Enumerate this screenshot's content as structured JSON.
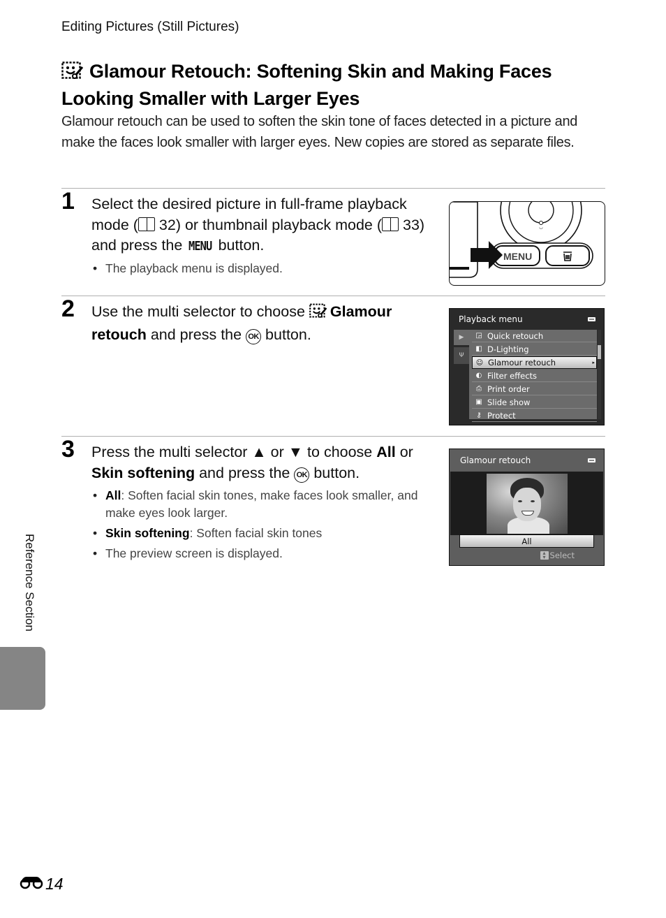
{
  "running_head": "Editing Pictures (Still Pictures)",
  "title": {
    "icon": "glamour-retouch-icon",
    "text": "Glamour Retouch: Softening Skin and Making Faces Looking Smaller with Larger Eyes"
  },
  "intro": "Glamour retouch can be used to soften the skin tone of faces detected in a picture and make the faces look smaller with larger eyes. New copies are stored as separate files.",
  "steps": [
    {
      "number": "1",
      "text_parts": {
        "a": "Select the desired picture in full-frame playback mode (",
        "ref1": "32",
        "b": ") or thumbnail playback mode (",
        "ref2": "33",
        "c": ") and press the ",
        "button": "MENU",
        "d": " button."
      },
      "bullets": [
        "The playback menu is displayed."
      ],
      "illustration": {
        "menu_label": "MENU",
        "delete_icon": "trash-icon"
      }
    },
    {
      "number": "2",
      "text_parts": {
        "a": "Use the multi selector to choose ",
        "bold": "Glamour retouch",
        "b": " and press the ",
        "ok": "OK",
        "c": " button."
      },
      "screen": {
        "title": "Playback menu",
        "tabs": [
          "playback-tab",
          "setup-tab"
        ],
        "items": [
          {
            "icon": "◲",
            "label": "Quick retouch"
          },
          {
            "icon": "◧",
            "label": "D-Lighting"
          },
          {
            "icon": "☺",
            "label": "Glamour retouch",
            "selected": true
          },
          {
            "icon": "◐",
            "label": "Filter effects"
          },
          {
            "icon": "⎙",
            "label": "Print order"
          },
          {
            "icon": "▣",
            "label": "Slide show"
          },
          {
            "icon": "⚷",
            "label": "Protect"
          }
        ]
      }
    },
    {
      "number": "3",
      "text_parts": {
        "a": "Press the multi selector ",
        "up": "▲",
        "or": " or ",
        "down": "▼",
        "b": " to choose ",
        "all": "All",
        "c": " or ",
        "skin": "Skin softening",
        "d": " and press the ",
        "ok": "OK",
        "e": " button."
      },
      "bullets": [
        {
          "bold": "All",
          "text": ": Soften facial skin tones, make faces look smaller, and make eyes look larger."
        },
        {
          "bold": "Skin softening",
          "text": ": Soften facial skin tones"
        },
        {
          "bold": "",
          "text": "The preview screen is displayed."
        }
      ],
      "screen": {
        "title": "Glamour retouch",
        "option": "All",
        "hint": "Select"
      }
    }
  ],
  "side_label": "Reference Section",
  "page_number": "14"
}
